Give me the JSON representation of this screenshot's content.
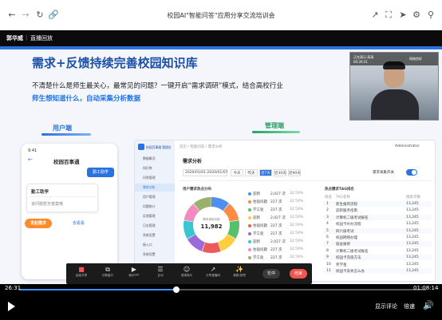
{
  "window": {
    "title": "校园AI\"智能问答\"应用分享交流培训会"
  },
  "header": {
    "presenter": "郭华威",
    "live_replay": "直播回放"
  },
  "slide": {
    "heading": "需求+反馈持续完善校园知识库",
    "subtitle_line1": "不清楚什么是师生最关心，最常见的问题？一键开启“需求调研”模式，结合高校行业",
    "subtitle_line2": "师生想知道什么，自动采集分析数据",
    "user_side_label": "用户端",
    "admin_side_label": "管理端",
    "phone": {
      "time": "9:41",
      "title": "校园百事通",
      "chip_button": "勤工助学",
      "bubble_title": "勤工助学",
      "bubble_sub": "该问题暂无答案哦",
      "action_btn": "发起需求",
      "text_btn": "去看看"
    },
    "dashboard": {
      "brand": "校园百事通 管理台",
      "breadcrumb": "首页 / 智能问答 / 需求分析",
      "page_title": "需求分析",
      "side_items": [
        "数据概况",
        "知识库",
        "问答管理",
        "需求分析",
        "用户管理",
        "问题统计",
        "反馈管理",
        "日志管理",
        "系统设置",
        "接入口",
        "系统设置"
      ],
      "date_range": "2020/01/01-2020/01/07",
      "filters": [
        "今天",
        "昨天",
        "近7天",
        "近30天",
        "近90天"
      ],
      "toggle_label": "需求采集开关",
      "user_name": "Administrator",
      "donut": {
        "title": "用户需求热点分布",
        "total_label": "需求调研总数",
        "total": "11,982"
      },
      "legend": [
        {
          "name": "迎新",
          "count": "2,027 次",
          "pct": "32.59%",
          "color": "#4f8ff0"
        },
        {
          "name": "住宿问题",
          "count": "227 次",
          "pct": "32.59%",
          "color": "#ff8c42"
        },
        {
          "name": "学工处",
          "count": "227 次",
          "pct": "32.59%",
          "color": "#57c06b"
        },
        {
          "name": "迎新",
          "count": "2,027 次",
          "pct": "32.59%",
          "color": "#ffce3d"
        },
        {
          "name": "住宿问题",
          "count": "227 次",
          "pct": "32.59%",
          "color": "#ec5b5b"
        },
        {
          "name": "学工处",
          "count": "227 次",
          "pct": "32.59%",
          "color": "#9b6bd9"
        },
        {
          "name": "迎新",
          "count": "2,027 次",
          "pct": "32.59%",
          "color": "#38c6d1"
        },
        {
          "name": "住宿问题",
          "count": "227 次",
          "pct": "32.59%",
          "color": "#f28cc0"
        },
        {
          "name": "学工处",
          "count": "227 次",
          "pct": "32.59%",
          "color": "#9ab06b"
        }
      ],
      "table": {
        "title": "热点需求TAG排名",
        "columns": [
          "排名",
          "TAG名称",
          "搜索次数"
        ],
        "rows": [
          [
            "1",
            "新生报到流程",
            "13,245"
          ],
          [
            "2",
            "迎新服务指南",
            "13,245"
          ],
          [
            "3",
            "计算机二级考试报名",
            "13,245"
          ],
          [
            "4",
            "校园卡补办流程",
            "13,245"
          ],
          [
            "5",
            "四六级考试",
            "13,245"
          ],
          [
            "6",
            "校园网络办理",
            "13,245"
          ],
          [
            "7",
            "宿舍报修",
            "13,245"
          ],
          [
            "8",
            "计算机二级考试报名",
            "13,245"
          ],
          [
            "9",
            "校园卡充值方法",
            "13,245"
          ],
          [
            "10",
            "奖学金",
            "13,245"
          ],
          [
            "11",
            "校园卡丢失怎么办",
            "13,245"
          ]
        ]
      }
    },
    "toolbar": {
      "items": [
        "结束共享",
        "切换窗口",
        "演示PPT",
        "互动",
        "邀请观众",
        "分享直播间",
        "美颜/滤镜"
      ],
      "pause": "暂停",
      "end": "结束"
    },
    "camera": {
      "badge": "正在演示·高清",
      "time": "00:26:31",
      "net": "网络良好"
    }
  },
  "player": {
    "current_time": "26:31",
    "total_time": "01:08:14",
    "progress_pct": 38.6,
    "show_comments": "显示评论",
    "speed": "倍速"
  },
  "colors": {
    "accent": "#2a72e0",
    "progress": "#3e8ef7",
    "end_button": "#f0554f"
  }
}
